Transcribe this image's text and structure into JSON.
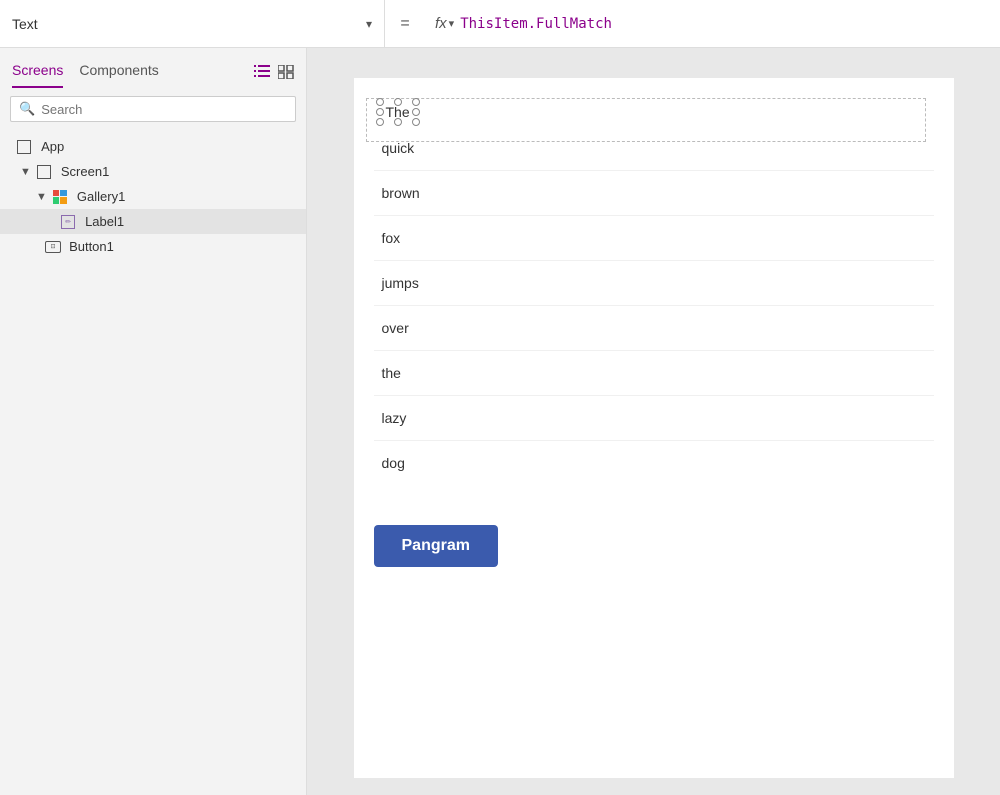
{
  "topbar": {
    "property_label": "Text",
    "equals": "=",
    "fx_label": "fx",
    "formula": "ThisItem.FullMatch"
  },
  "left_panel": {
    "tabs": [
      {
        "id": "screens",
        "label": "Screens",
        "active": true
      },
      {
        "id": "components",
        "label": "Components",
        "active": false
      }
    ],
    "search_placeholder": "Search",
    "list_icon": "≡",
    "grid_icon": "⊞",
    "tree": [
      {
        "id": "app",
        "label": "App",
        "indent": 0,
        "icon": "app",
        "chevron": ""
      },
      {
        "id": "screen1",
        "label": "Screen1",
        "indent": 1,
        "icon": "screen",
        "chevron": "▼"
      },
      {
        "id": "gallery1",
        "label": "Gallery1",
        "indent": 2,
        "icon": "gallery",
        "chevron": "▼"
      },
      {
        "id": "label1",
        "label": "Label1",
        "indent": 3,
        "icon": "label",
        "chevron": "",
        "selected": true
      },
      {
        "id": "button1",
        "label": "Button1",
        "indent": 2,
        "icon": "button",
        "chevron": ""
      }
    ]
  },
  "canvas": {
    "gallery_items": [
      "The",
      "quick",
      "brown",
      "fox",
      "jumps",
      "over",
      "the",
      "lazy",
      "dog"
    ],
    "button_label": "Pangram"
  }
}
